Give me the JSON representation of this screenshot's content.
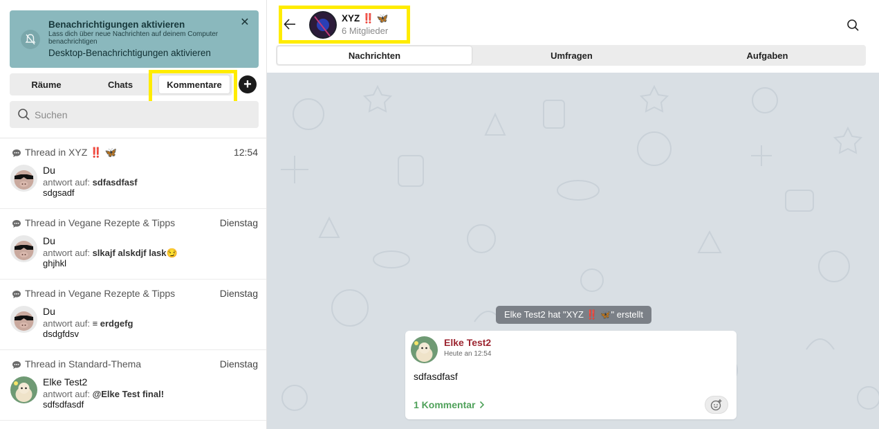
{
  "notification": {
    "title": "Benachrichtigungen aktivieren",
    "description": "Lass dich über neue Nachrichten auf deinem Computer benachrichtigen",
    "action": "Desktop-Benachrichtigungen aktivieren",
    "close": "✕",
    "icon": "bell-off-icon",
    "color": "#8ab8bd"
  },
  "left_tabs": [
    {
      "label": "Räume"
    },
    {
      "label": "Chats"
    },
    {
      "label": "Kommentare"
    }
  ],
  "add_button": "+",
  "search": {
    "placeholder": "Suchen"
  },
  "threads": [
    {
      "thread": "Thread in XYZ ‼️ 🦋",
      "time": "12:54",
      "name": "Du",
      "reply_prefix": "antwort auf:",
      "reply": "sdfasdfasf",
      "last": "sdgsadf",
      "avatar": "pig-avatar"
    },
    {
      "thread": "Thread in Vegane Rezepte & Tipps",
      "time": "Dienstag",
      "name": "Du",
      "reply_prefix": "antwort auf:",
      "reply": "slkajf alskdjf lask😏",
      "last": "ghjhkl",
      "avatar": "pig-avatar"
    },
    {
      "thread": "Thread in Vegane Rezepte & Tipps",
      "time": "Dienstag",
      "name": "Du",
      "reply_prefix": "antwort auf:",
      "reply": "≡ erdgefg",
      "last": "dsdgfdsv",
      "avatar": "pig-avatar"
    },
    {
      "thread": "Thread in Standard-Thema",
      "time": "Dienstag",
      "name": "Elke Test2",
      "reply_prefix": "antwort auf:",
      "reply": "@Elke Test final!",
      "last": "sdfsdfasdf",
      "avatar": "llama-avatar"
    }
  ],
  "room": {
    "name": "XYZ ‼️ 🦋",
    "members": "6 Mitglieder"
  },
  "right_tabs": [
    {
      "label": "Nachrichten"
    },
    {
      "label": "Umfragen"
    },
    {
      "label": "Aufgaben"
    }
  ],
  "system_message": "Elke Test2 hat \"XYZ ‼️ 🦋\" erstellt",
  "message": {
    "author": "Elke Test2",
    "timestamp": "Heute an 12:54",
    "text": "sdfasdfasf",
    "comments": "1 Kommentar"
  },
  "colors": {
    "highlight": "#ffec00",
    "author": "#9c2530",
    "comments": "#4fa15a",
    "chat_bg": "#d9dfe4"
  }
}
